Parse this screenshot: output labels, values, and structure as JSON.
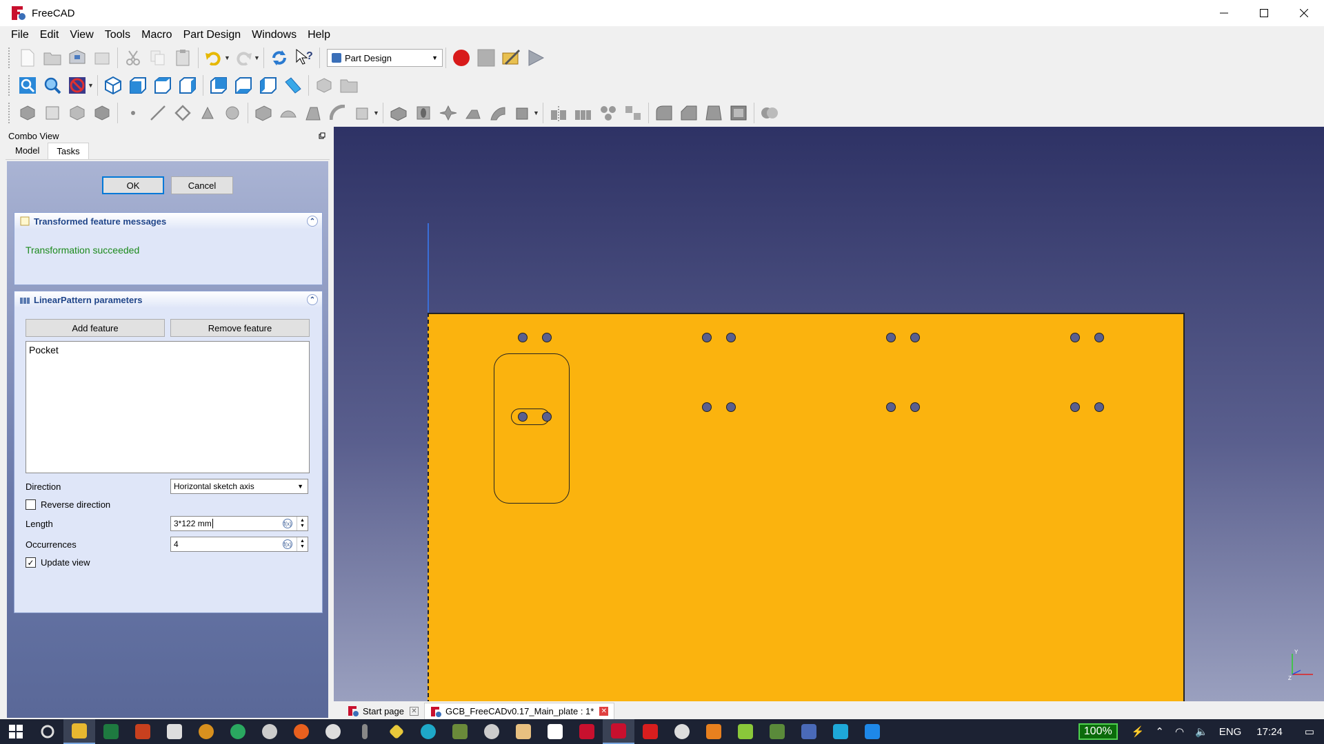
{
  "window": {
    "title": "FreeCAD"
  },
  "menu": [
    "File",
    "Edit",
    "View",
    "Tools",
    "Macro",
    "Part Design",
    "Windows",
    "Help"
  ],
  "workbench": {
    "selected": "Part Design"
  },
  "combo_view": {
    "title": "Combo View",
    "tabs": [
      "Model",
      "Tasks"
    ],
    "active_tab": "Tasks",
    "ok_label": "OK",
    "cancel_label": "Cancel",
    "messages_panel": {
      "title": "Transformed feature messages",
      "message": "Transformation succeeded",
      "message_color": "#1c8a1c"
    },
    "params_panel": {
      "title": "LinearPattern parameters",
      "add_feature": "Add feature",
      "remove_feature": "Remove feature",
      "features": [
        "Pocket"
      ],
      "direction_label": "Direction",
      "direction_value": "Horizontal sketch axis",
      "reverse_label": "Reverse direction",
      "reverse_checked": false,
      "length_label": "Length",
      "length_value": "3*122 mm",
      "occurrences_label": "Occurrences",
      "occurrences_value": "4",
      "update_label": "Update view",
      "update_checked": true
    }
  },
  "viewport": {
    "plate_color": "#fbb30e"
  },
  "doc_tabs": [
    {
      "label": "Start page",
      "active": false
    },
    {
      "label": "GCB_FreeCADv0.17_Main_plate : 1*",
      "active": true
    }
  ],
  "taskbar": {
    "battery": "100%",
    "language": "ENG",
    "time": "17:24"
  }
}
